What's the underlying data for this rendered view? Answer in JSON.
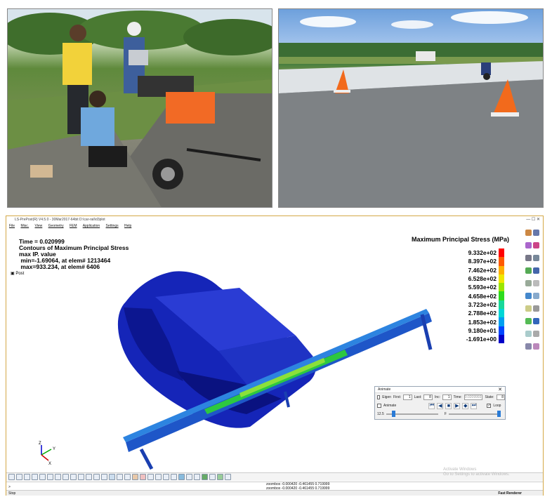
{
  "window": {
    "title": "LS-PrePost(R) V4.5.0 - 30Mar2017-64bit D:\\car-rail\\d3plot",
    "controls": "—  ☐  ✕"
  },
  "menu": [
    "File",
    "Misc.",
    "View",
    "Geometry",
    "FEM",
    "Application",
    "Settings",
    "Help"
  ],
  "info": {
    "time": "Time =    0.020999",
    "contours": "Contours of Maximum Principal Stress",
    "value_type": "max IP. value",
    "min": " min=-1.69064, at elem# 1213464",
    "max": " max=933.234, at elem# 6406"
  },
  "post_label": "Post",
  "legend": {
    "title": "Maximum Principal Stress (MPa)",
    "levels": [
      "9.332e+02",
      "8.397e+02",
      "7.462e+02",
      "6.528e+02",
      "5.593e+02",
      "4.658e+02",
      "3.723e+02",
      "2.788e+02",
      "1.853e+02",
      "9.180e+01",
      "-1.691e+00"
    ],
    "colors": [
      "#ff0000",
      "#ff5a00",
      "#ffb000",
      "#f0e800",
      "#9be600",
      "#2ddc1e",
      "#18d89a",
      "#00d6d6",
      "#00a0f0",
      "#0046ff",
      "#0000c8"
    ]
  },
  "animate": {
    "title": "Animate",
    "eigen_label": "Eigen",
    "first_label": "First:",
    "first_value": "1",
    "last_label": "Last:",
    "last_value": "8",
    "inc_label": "Inc:",
    "inc_value": "1",
    "time_label": "Time:",
    "time_value": "0.0209993",
    "state_label": "State:",
    "state_value": "8",
    "animate_label": "Animate",
    "loop_label": "Loop",
    "speed_value": "12.5",
    "frame_label": "F"
  },
  "command_line": {
    "prompt": ">",
    "line1": "zoombox -0.000420 -0.461455 0.719999",
    "line2": "zoombox -0.000420 -0.461455 0.719999"
  },
  "status": {
    "left": "Stop",
    "right": "Fast Renderer"
  },
  "watermark": {
    "line1": "Activate Windows",
    "line2": "Go to Settings to activate Windows."
  }
}
